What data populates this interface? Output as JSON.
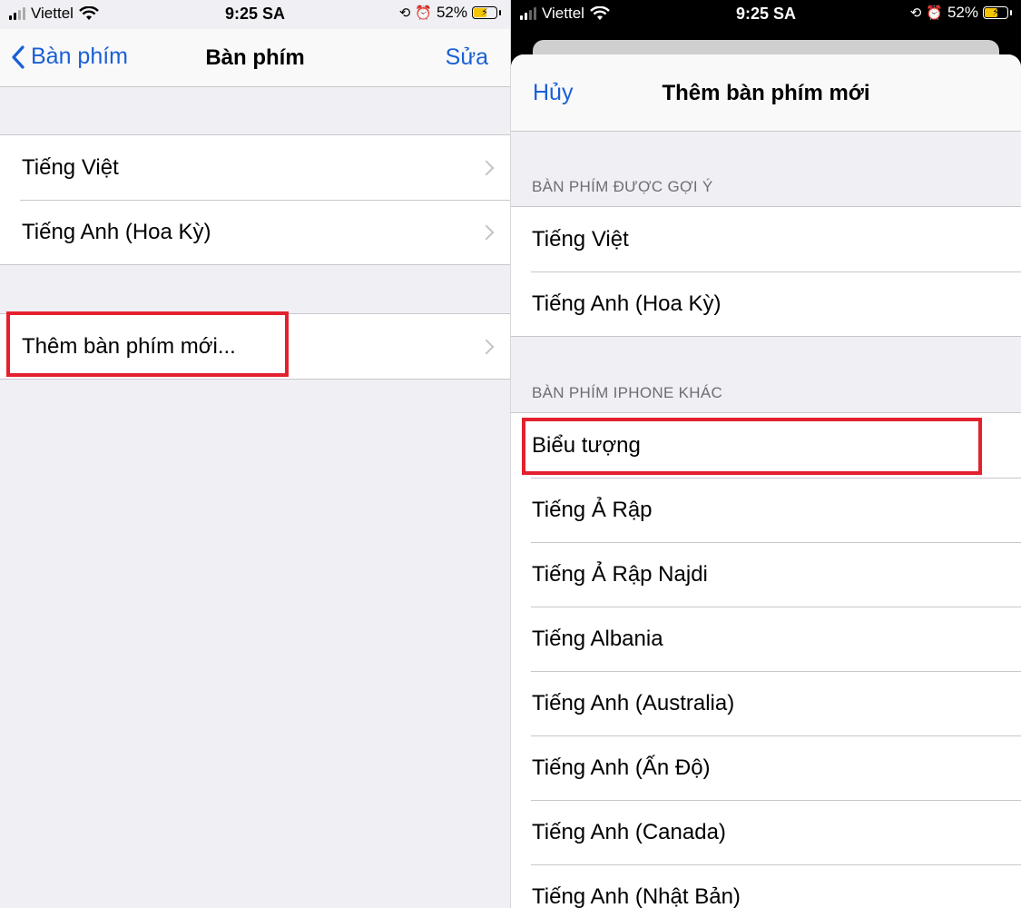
{
  "status": {
    "carrier": "Viettel",
    "time": "9:25 SA",
    "battery": "52%",
    "battery_level": 0.52
  },
  "left": {
    "nav": {
      "back_label": "Bàn phím",
      "title": "Bàn phím",
      "action": "Sửa"
    },
    "keyboards": [
      {
        "label": "Tiếng Việt"
      },
      {
        "label": "Tiếng Anh (Hoa Kỳ)"
      }
    ],
    "add_keyboard": "Thêm bàn phím mới..."
  },
  "right": {
    "header": {
      "cancel": "Hủy",
      "title": "Thêm bàn phím mới"
    },
    "suggested": {
      "label": "BÀN PHÍM ĐƯỢC GỢI Ý",
      "items": [
        "Tiếng Việt",
        "Tiếng Anh (Hoa Kỳ)"
      ]
    },
    "other": {
      "label": "BÀN PHÍM IPHONE KHÁC",
      "items": [
        "Biểu tượng",
        "Tiếng Ả Rập",
        "Tiếng Ả Rập Najdi",
        "Tiếng Albania",
        "Tiếng Anh (Australia)",
        "Tiếng Anh (Ấn Độ)",
        "Tiếng Anh (Canada)",
        "Tiếng Anh (Nhật Bản)"
      ]
    }
  },
  "colors": {
    "accent": "#1a5fd6",
    "highlight": "#e3212e",
    "grouped_bg": "#efeff4",
    "battery_fill": "#f5c400"
  }
}
